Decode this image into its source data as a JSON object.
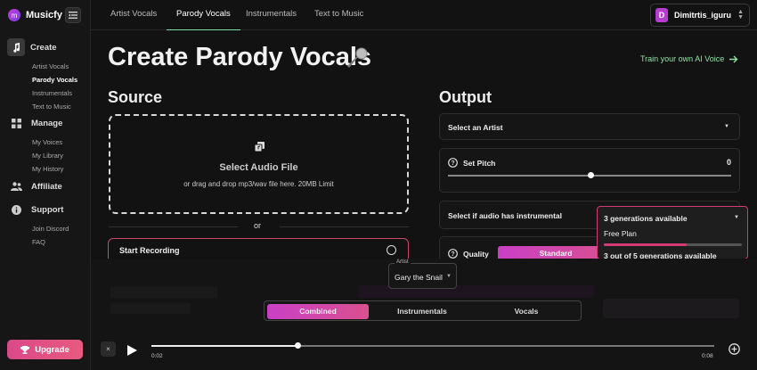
{
  "app": {
    "name": "Musicfy",
    "logo_letter": "m"
  },
  "sidebar": {
    "sections": [
      {
        "title": "Create",
        "icon": "music-note-icon",
        "items": [
          "Artist Vocals",
          "Parody Vocals",
          "Instrumentals",
          "Text to Music"
        ],
        "active_item": "Parody Vocals"
      },
      {
        "title": "Manage",
        "icon": "grid-icon",
        "items": [
          "My Voices",
          "My Library",
          "My History"
        ]
      },
      {
        "title": "Affiliate",
        "icon": "people-icon",
        "items": []
      },
      {
        "title": "Support",
        "icon": "info-icon",
        "items": [
          "Join Discord",
          "FAQ"
        ]
      }
    ],
    "upgrade_label": "Upgrade"
  },
  "topbar": {
    "tabs": [
      "Artist Vocals",
      "Parody Vocals",
      "Instrumentals",
      "Text to Music"
    ],
    "active_tab": "Parody Vocals",
    "user": {
      "initial": "D",
      "name": "Dimitrtis_iguru"
    }
  },
  "page": {
    "title": "Create Parody Vocals",
    "title_emoji": "microphone-icon",
    "train_link": "Train your own AI Voice"
  },
  "source": {
    "heading": "Source",
    "upload_title": "Select Audio File",
    "upload_subtitle": "or drag and drop mp3/wav file here. 20MB Limit",
    "or_label": "or",
    "record_label": "Start Recording"
  },
  "output": {
    "heading": "Output",
    "artist_select": "Select an Artist",
    "pitch_label": "Set Pitch",
    "pitch_value": "0",
    "pitch_fraction": 0.5,
    "instrumental_label": "Select if audio has instrumental",
    "quality_label": "Quality",
    "quality_option": "Standard"
  },
  "quota": {
    "headline": "3 generations available",
    "plan": "Free Plan",
    "used_fraction": 0.6,
    "detail": "3 out of 5 generations available"
  },
  "player": {
    "artist_caption": "Artist",
    "artist_value": "Gary the Snail",
    "modes": [
      "Combined",
      "Instrumentals",
      "Vocals"
    ],
    "active_mode": "Combined",
    "current_time": "0:02",
    "end_time": "0:08",
    "progress_fraction": 0.26,
    "close_label": "×"
  },
  "colors": {
    "accent_green": "#8ee0a0",
    "accent_pink": "#d23b74",
    "accent_purple": "#c940c6",
    "bg": "#121212"
  }
}
